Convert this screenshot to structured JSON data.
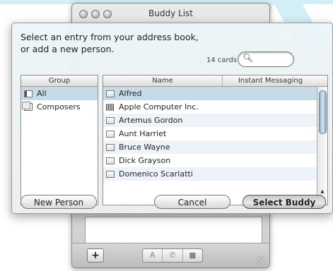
{
  "buddy_window": {
    "title": "Buddy List",
    "add_button": "+",
    "segments": [
      "A",
      "✆",
      "■"
    ]
  },
  "dialog": {
    "prompt_line1": "Select an entry from your address book,",
    "prompt_line2": "or add a new person.",
    "card_count": "14 cards",
    "search": {
      "value": "",
      "placeholder": ""
    },
    "group_column_header": "Group",
    "groups": [
      {
        "label": "All",
        "selected": true
      },
      {
        "label": "Composers",
        "selected": false
      }
    ],
    "name_column_header": "Name",
    "im_column_header": "Instant Messaging",
    "names": [
      {
        "label": "Alfred",
        "icon": "card-icon"
      },
      {
        "label": "Apple Computer Inc.",
        "icon": "building-icon"
      },
      {
        "label": "Artemus Gordon",
        "icon": "card-icon"
      },
      {
        "label": "Aunt Harriet",
        "icon": "card-icon"
      },
      {
        "label": "Bruce Wayne",
        "icon": "card-icon"
      },
      {
        "label": "Dick Grayson",
        "icon": "card-icon"
      },
      {
        "label": "Domenico Scarlatti",
        "icon": "card-icon"
      }
    ],
    "buttons": {
      "new_person": "New Person",
      "cancel": "Cancel",
      "select_buddy": "Select Buddy"
    }
  },
  "colors": {
    "selection": "#c6dbe8",
    "highlight_beam": "#d3eff6"
  }
}
